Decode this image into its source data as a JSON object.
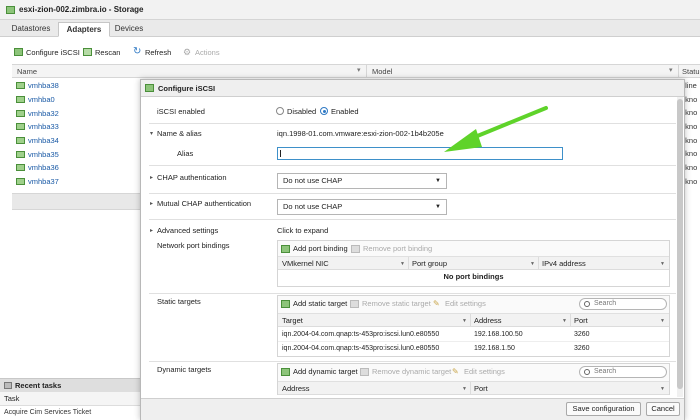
{
  "window": {
    "title": "esxi-zion-002.zimbra.io - Storage"
  },
  "tabs": [
    {
      "label": "Datastores"
    },
    {
      "label": "Adapters"
    },
    {
      "label": "Devices"
    }
  ],
  "toolbar": {
    "configure_iscsi": "Configure iSCSI",
    "rescan": "Rescan",
    "refresh": "Refresh",
    "actions": "Actions"
  },
  "grid": {
    "columns": {
      "name": "Name",
      "model": "Model",
      "status": "Statu"
    },
    "rows": [
      {
        "name": "vmhba38",
        "status": "nline"
      },
      {
        "name": "vmhba0",
        "status": "nkno"
      },
      {
        "name": "vmhba32",
        "status": "nkno"
      },
      {
        "name": "vmhba33",
        "status": "nkno"
      },
      {
        "name": "vmhba34",
        "status": "nkno"
      },
      {
        "name": "vmhba35",
        "status": "nkno"
      },
      {
        "name": "vmhba36",
        "status": "nkno"
      },
      {
        "name": "vmhba37",
        "status": "nkno"
      }
    ]
  },
  "recent_tasks": {
    "title": "Recent tasks",
    "task_col": "Task",
    "rows": [
      "Acquire Cim Services Ticket"
    ]
  },
  "modal": {
    "title": "Configure iSCSI",
    "iscsi_enabled": {
      "label": "iSCSI enabled",
      "disabled": "Disabled",
      "enabled": "Enabled",
      "selected": "Enabled"
    },
    "name_alias": {
      "label": "Name & alias",
      "value": "iqn.1998-01.com.vmware:esxi-zion-002-1b4b205e"
    },
    "alias": {
      "label": "Alias",
      "value": ""
    },
    "chap": {
      "label": "CHAP authentication",
      "value": "Do not use CHAP"
    },
    "mutual_chap": {
      "label": "Mutual CHAP authentication",
      "value": "Do not use CHAP"
    },
    "advanced": {
      "label": "Advanced settings",
      "value": "Click to expand"
    },
    "port_bindings": {
      "label": "Network port bindings",
      "add": "Add port binding",
      "remove": "Remove port binding",
      "columns": [
        "VMkernel NIC",
        "Port group",
        "IPv4 address"
      ],
      "empty": "No port bindings"
    },
    "static_targets": {
      "label": "Static targets",
      "add": "Add static target",
      "remove": "Remove static target",
      "edit": "Edit settings",
      "search": "Search",
      "columns": [
        "Target",
        "Address",
        "Port"
      ],
      "rows": [
        {
          "target": "iqn.2004-04.com.qnap:ts-453pro:iscsi.lun0.e80550",
          "address": "192.168.100.50",
          "port": "3260"
        },
        {
          "target": "iqn.2004-04.com.qnap:ts-453pro:iscsi.lun0.e80550",
          "address": "192.168.1.50",
          "port": "3260"
        }
      ]
    },
    "dynamic_targets": {
      "label": "Dynamic targets",
      "add": "Add dynamic target",
      "remove": "Remove dynamic target",
      "edit": "Edit settings",
      "search": "Search",
      "columns": [
        "Address",
        "Port"
      ]
    },
    "buttons": {
      "save": "Save configuration",
      "cancel": "Cancel"
    }
  },
  "colors": {
    "accent": "#2f79c4",
    "link": "#1a5aa6",
    "annotation_arrow": "#5fd32a"
  }
}
